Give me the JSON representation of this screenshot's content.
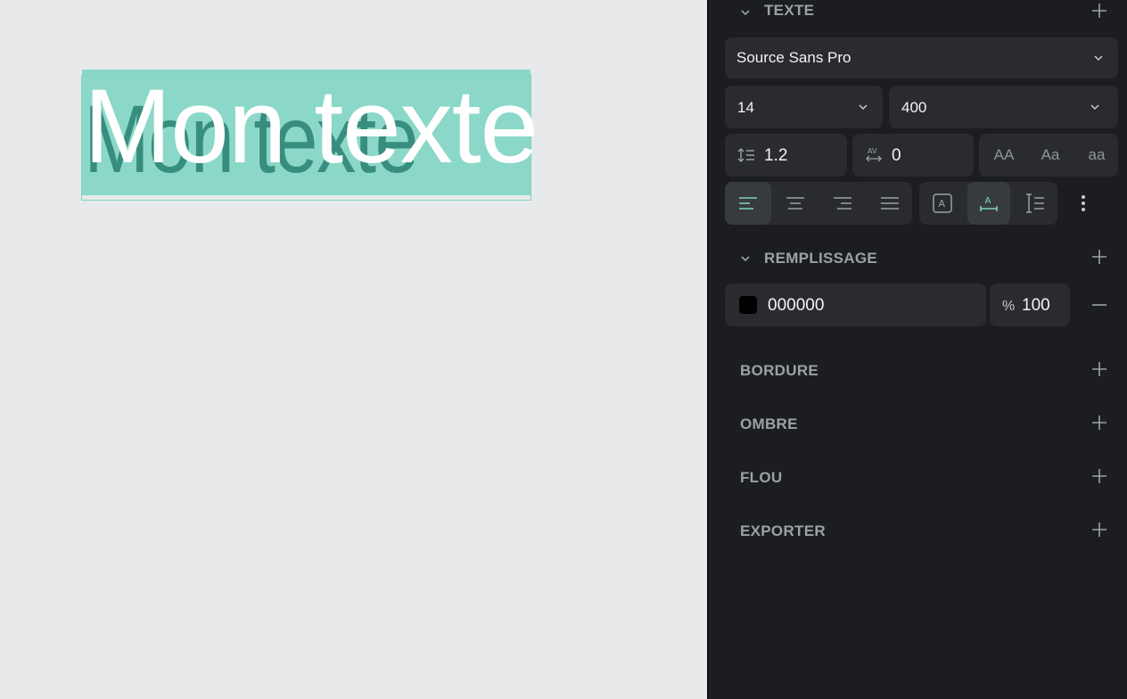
{
  "canvas": {
    "text_content": "Mon texte"
  },
  "text_section": {
    "title": "TEXTE",
    "font_family": "Source Sans Pro",
    "font_size": "14",
    "font_weight": "400",
    "line_height": "1.2",
    "letter_spacing": "0",
    "case_upper": "AA",
    "case_title": "Aa",
    "case_lower": "aa"
  },
  "fill_section": {
    "title": "REMPLISSAGE",
    "hex": "000000",
    "percent_sign": "%",
    "opacity": "100",
    "color": "#000000"
  },
  "sections": {
    "border": "BORDURE",
    "shadow": "OMBRE",
    "blur": "FLOU",
    "export": "EXPORTER"
  },
  "colors": {
    "accent": "#7fd3c2",
    "panel_bg": "#1c1d20",
    "canvas_bg": "#e8e9ea"
  }
}
